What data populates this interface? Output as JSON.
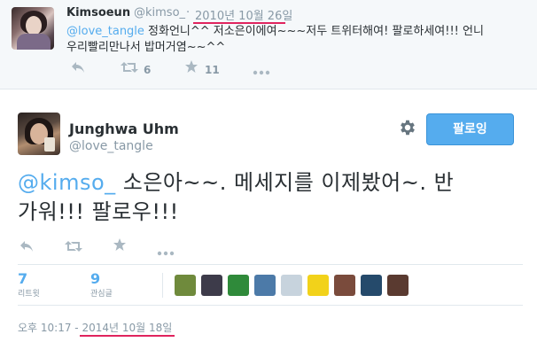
{
  "top_tweet": {
    "name": "Kimsoeun",
    "handle": "@kimso_",
    "separator": "·",
    "date": "2010년 10월 26일",
    "mention": "@love_tangle",
    "text_line1": " 정화언니^^ 저소은이에여~~~저두 트위터해여! 팔로하세여!!! 언니",
    "text_line2": "우리빨리만나서 밥머거염~~^^",
    "retweet_count": "6",
    "favorite_count": "11",
    "icons": [
      "reply-icon",
      "retweet-icon",
      "favorite-icon",
      "more-icon"
    ]
  },
  "main_tweet": {
    "name": "Junghwa Uhm",
    "handle": "@love_tangle",
    "follow_label": "팔로잉",
    "mention": "@kimso_",
    "text_line1": " 소은아~~. 메세지를 이제봤어~. 반",
    "text_line2": "가워!!!  팔로우!!!",
    "stats": {
      "retweets_value": "7",
      "retweets_label": "리트윗",
      "favorites_value": "9",
      "favorites_label": "관심글"
    },
    "favoriter_avatars": [
      {
        "name": "favoriter-avatar-1",
        "color": "#6f8a3c"
      },
      {
        "name": "favoriter-avatar-2",
        "color": "#3d3b4a"
      },
      {
        "name": "favoriter-avatar-3",
        "color": "#2f8a3a"
      },
      {
        "name": "favoriter-avatar-4",
        "color": "#4c7aa8"
      },
      {
        "name": "favoriter-avatar-5",
        "color": "#c7d3dd"
      },
      {
        "name": "favoriter-avatar-6",
        "color": "#f2d21a"
      },
      {
        "name": "favoriter-avatar-7",
        "color": "#7a4b3c"
      },
      {
        "name": "favoriter-avatar-8",
        "color": "#254a6b"
      },
      {
        "name": "favoriter-avatar-9",
        "color": "#5a3a30"
      }
    ],
    "time": "오후 10:17",
    "date_separator": " - ",
    "date": "2014년 10월 18일"
  },
  "colors": {
    "accent": "#55acee",
    "underline": "#e0245e",
    "muted": "#8899a6"
  }
}
